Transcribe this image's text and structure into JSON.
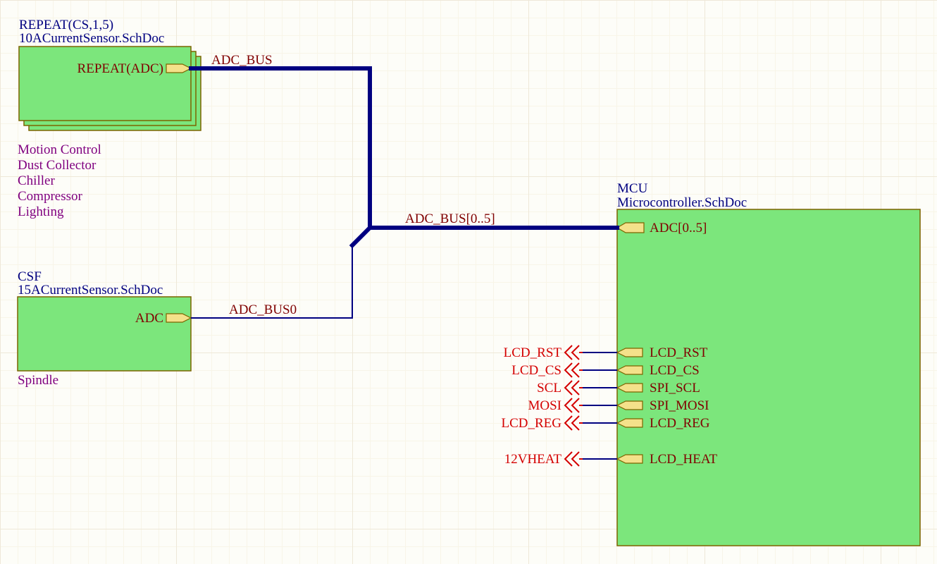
{
  "sheet_cs": {
    "designator": "REPEAT(CS,1,5)",
    "filename": "10ACurrentSensor.SchDoc",
    "port": "REPEAT(ADC)",
    "notes": [
      "Motion Control",
      "Dust Collector",
      "Chiller",
      "Compressor",
      "Lighting"
    ]
  },
  "sheet_csf": {
    "designator": "CSF",
    "filename": "15ACurrentSensor.SchDoc",
    "port": "ADC",
    "notes": [
      "Spindle"
    ]
  },
  "sheet_mcu": {
    "designator": "MCU",
    "filename": "Microcontroller.SchDoc",
    "ports": {
      "adc_bus": "ADC[0..5]",
      "lcd_rst": "LCD_RST",
      "lcd_cs": "LCD_CS",
      "spi_scl": "SPI_SCL",
      "spi_mosi": "SPI_MOSI",
      "lcd_reg": "LCD_REG",
      "lcd_heat": "LCD_HEAT"
    }
  },
  "nets": {
    "adc_bus": "ADC_BUS",
    "adc_bus0": "ADC_BUS0",
    "adc_bus_range": "ADC_BUS[0..5]"
  },
  "off_sheet": {
    "lcd_rst": "LCD_RST",
    "lcd_cs": "LCD_CS",
    "scl": "SCL",
    "mosi": "MOSI",
    "lcd_reg": "LCD_REG",
    "heat": "12VHEAT"
  }
}
